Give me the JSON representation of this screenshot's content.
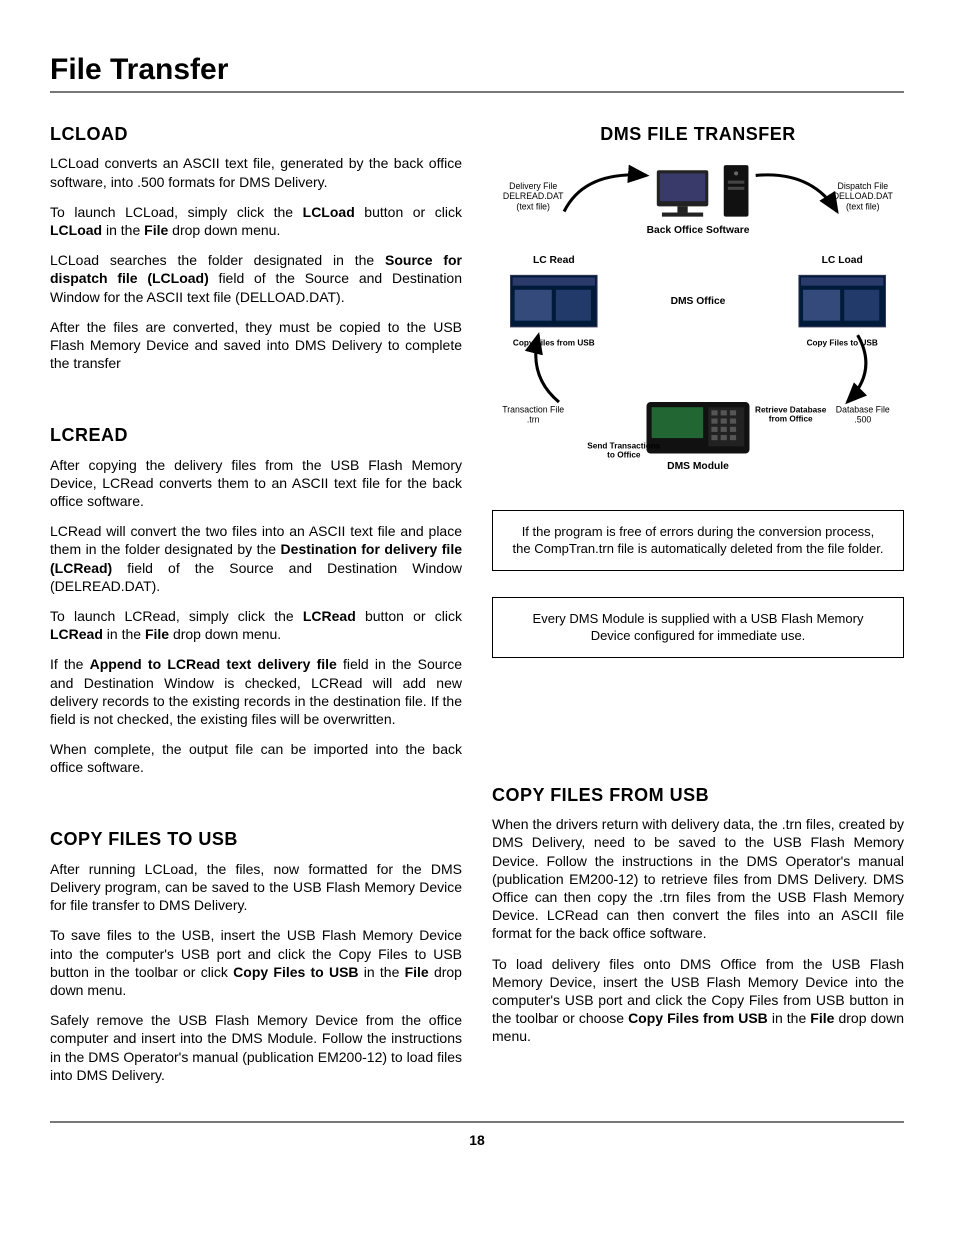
{
  "page_title": "File Transfer",
  "page_number": "18",
  "lcload": {
    "heading": "LCLOAD",
    "p1a": "LCLoad converts an ASCII text file, generated by the back office software, into .500 formats for DMS Delivery.",
    "p2a": "To launch LCLoad, simply click the ",
    "p2b": "LCLoad",
    "p2c": " button or click ",
    "p2d": "LCLoad",
    "p2e": " in the ",
    "p2f": "File",
    "p2g": " drop down menu.",
    "p3a": "LCLoad searches the folder designated in the ",
    "p3b": "Source for dispatch file (LCLoad)",
    "p3c": " field of the Source and Destination Window for the ASCII text file (DELLOAD.DAT).",
    "p4": "After the files are converted, they must be copied to the USB Flash Memory Device and saved into DMS Delivery to complete the transfer"
  },
  "lcread": {
    "heading": "LCREAD",
    "p1": "After copying the delivery files from the USB Flash Memory Device, LCRead converts them to an ASCII text file for the back office software.",
    "p2a": "LCRead will convert the two files into an ASCII text file and place them in the folder designated by the ",
    "p2b": "Destination for delivery file (LCRead)",
    "p2c": " field of the Source and Destination Window (DELREAD.DAT).",
    "p3a": "To launch LCRead, simply click the ",
    "p3b": "LCRead",
    "p3c": " button or click ",
    "p3d": "LCRead",
    "p3e": " in the ",
    "p3f": "File",
    "p3g": " drop down menu.",
    "p4a": "If the ",
    "p4b": "Append to LCRead text delivery file",
    "p4c": " field in the Source and Destination Window is checked, LCRead will add new delivery records to the existing records in the destination file. If the field is not checked, the existing files will be overwritten.",
    "p5": "When complete, the output file can be imported into the back office software."
  },
  "copy_to": {
    "heading": "COPY FILES TO USB",
    "p1": "After running LCLoad, the files, now formatted for the DMS Delivery program, can be saved to the USB Flash Memory Device for file transfer to DMS Delivery.",
    "p2a": "To save files to the USB, insert the USB Flash Memory Device into the computer's USB port and click the Copy Files to USB button in the toolbar or click ",
    "p2b": "Copy Files to USB",
    "p2c": " in the ",
    "p2d": "File",
    "p2e": " drop down menu.",
    "p3": "Safely remove the USB Flash Memory Device from the office computer and insert into the DMS Module. Follow the instructions in the DMS Operator's manual (publication EM200-12) to load files into DMS Delivery."
  },
  "copy_from": {
    "heading": "COPY FILES FROM USB",
    "p1": "When the drivers return with delivery data, the .trn files, created by DMS Delivery, need to be saved to the USB Flash Memory Device. Follow the instructions in the DMS Operator's manual (publication EM200-12) to retrieve files from DMS Delivery. DMS Office can then copy the .trn files from the USB Flash Memory Device. LCRead can then convert the files into an ASCII file format for the back office software.",
    "p2a": "To load delivery files onto DMS Office from the USB Flash Memory Device, insert the USB Flash Memory Device into the computer's USB port and click the Copy Files from USB button in the toolbar or choose ",
    "p2b": "Copy Files from USB",
    "p2c": " in the ",
    "p2d": "File",
    "p2e": " drop down menu."
  },
  "right": {
    "heading": "DMS FILE TRANSFER",
    "note1": "If the program is free of errors during the conversion process, the CompTran.trn file is automatically deleted from the file folder.",
    "note2": "Every DMS Module is supplied with a USB Flash Memory Device configured for immediate use."
  },
  "diagram": {
    "delivery_file_l1": "Delivery File",
    "delivery_file_l2": "DELREAD.DAT",
    "delivery_file_l3": "(text file)",
    "dispatch_file_l1": "Dispatch File",
    "dispatch_file_l2": "DELLOAD.DAT",
    "dispatch_file_l3": "(text file)",
    "back_office": "Back Office Software",
    "lc_read": "LC Read",
    "lc_load": "LC Load",
    "dms_office": "DMS Office",
    "copy_from_usb": "Copy Files from USB",
    "copy_to_usb": "Copy Files to USB",
    "transaction_l1": "Transaction File",
    "transaction_l2": ".trn",
    "database_l1": "Database File",
    "database_l2": ".500",
    "retrieve_l1": "Retrieve Database",
    "retrieve_l2": "from Office",
    "send_l1": "Send Transactions",
    "send_l2": "to Office",
    "dms_module": "DMS Module"
  }
}
